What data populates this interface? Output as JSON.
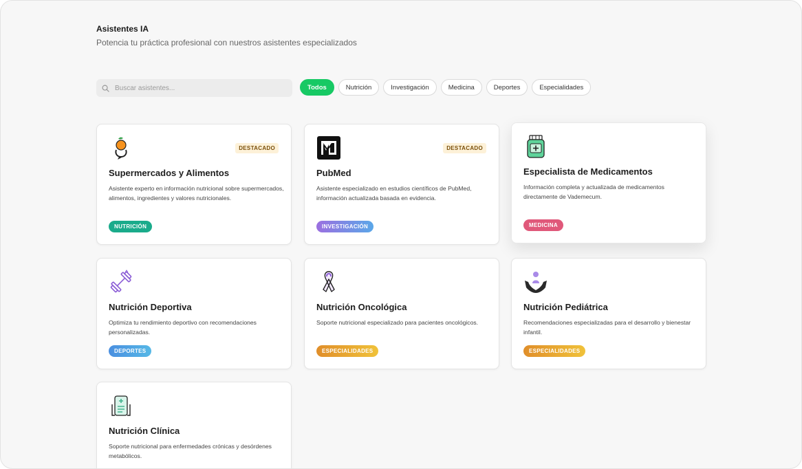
{
  "header": {
    "title": "Asistentes IA",
    "subtitle": "Potencia tu práctica profesional con nuestros asistentes especializados"
  },
  "search": {
    "placeholder": "Buscar asistentes..."
  },
  "filters": [
    "Todos",
    "Nutrición",
    "Investigación",
    "Medicina",
    "Deportes",
    "Especialidades"
  ],
  "active_filter": "Todos",
  "cards": [
    {
      "title": "Supermercados y Alimentos",
      "description": "Asistente experto en información nutricional sobre supermercados, alimentos, ingredientes y valores nutricionales.",
      "badge": "DESTACADO",
      "tag": "NUTRICIÓN",
      "icon": "orange-person-icon"
    },
    {
      "title": "PubMed",
      "description": "Asistente especializado en estudios científicos de PubMed, información actualizada basada en evidencia.",
      "badge": "DESTACADO",
      "tag": "INVESTIGACIÓN",
      "icon": "pubmed-logo-icon"
    },
    {
      "title": "Especialista de Medicamentos",
      "description": "Información completa y actualizada de medicamentos directamente de Vademecum.",
      "tag": "MEDICINA",
      "icon": "medicine-bottle-icon"
    },
    {
      "title": "Nutrición Deportiva",
      "description": "Optimiza tu rendimiento deportivo con recomendaciones personalizadas.",
      "tag": "DEPORTES",
      "icon": "dumbbell-icon"
    },
    {
      "title": "Nutrición Oncológica",
      "description": "Soporte nutricional especializado para pacientes oncológicos.",
      "tag": "ESPECIALIDADES",
      "icon": "awareness-ribbon-icon"
    },
    {
      "title": "Nutrición Pediátrica",
      "description": "Recomendaciones especializadas para el desarrollo y bienestar infantil.",
      "tag": "ESPECIALIDADES",
      "icon": "child-care-hands-icon"
    },
    {
      "title": "Nutrición Clínica",
      "description": "Soporte nutricional para enfermedades crónicas y desórdenes metabólicos.",
      "icon": "clinical-clipboard-icon"
    }
  ],
  "colors": {
    "active_filter": "#17c964",
    "tag_nutricion": "#1aab8b",
    "tag_investigacion": "#8f7ce8",
    "tag_medicina": "#e0587a",
    "tag_deportes": "#4aa3e0",
    "tag_especialidades": "#e7a52a",
    "badge_bg": "#fdf1d8"
  }
}
